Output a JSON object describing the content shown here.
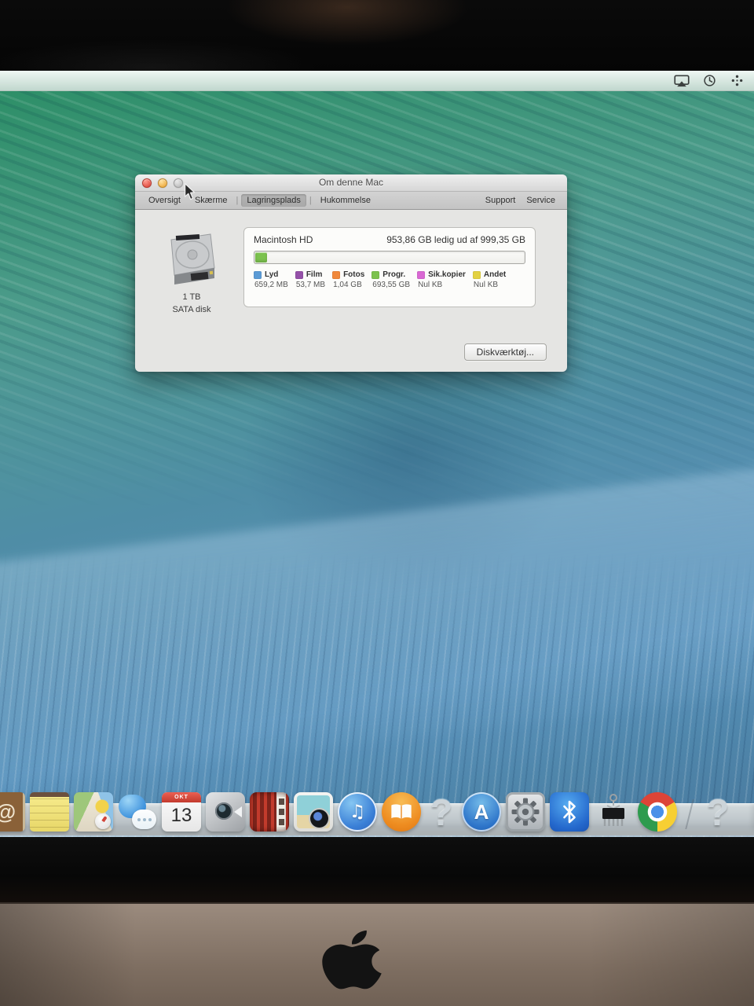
{
  "menubar": {
    "icons": [
      {
        "name": "airplay-icon"
      },
      {
        "name": "time-machine-icon"
      },
      {
        "name": "menu-extra-icon"
      }
    ]
  },
  "window": {
    "title": "Om denne Mac",
    "tabs": [
      {
        "label": "Oversigt",
        "active": false
      },
      {
        "label": "Skærme",
        "active": false
      },
      {
        "label": "Lagringsplads",
        "active": true
      },
      {
        "label": "Hukommelse",
        "active": false
      }
    ],
    "tab_separator": "|",
    "support_label": "Support",
    "service_label": "Service",
    "storage": {
      "disk_name": "Macintosh HD",
      "free_text": "953,86 GB ledig ud af 999,35 GB",
      "disk_size_label": "1 TB",
      "disk_type_label": "SATA disk",
      "bar": {
        "used_percent": 4.3,
        "used_color": "#7cc24e"
      },
      "legend": [
        {
          "label": "Lyd",
          "value": "659,2 MB",
          "color": "#5b9bd5"
        },
        {
          "label": "Film",
          "value": "53,7 MB",
          "color": "#9451a8"
        },
        {
          "label": "Fotos",
          "value": "1,04 GB",
          "color": "#f0883c"
        },
        {
          "label": "Progr.",
          "value": "693,55 GB",
          "color": "#7cc24e"
        },
        {
          "label": "Sik.kopier",
          "value": "Nul KB",
          "color": "#d969d3"
        },
        {
          "label": "Andet",
          "value": "Nul KB",
          "color": "#e3d141"
        }
      ],
      "disk_utility_button": "Diskværktøj..."
    }
  },
  "dock": {
    "calendar": {
      "month": "OKT",
      "day": "13"
    },
    "glyphs": {
      "contacts": "@",
      "app_store": "A",
      "missing": "?",
      "itunes": "♫"
    },
    "items": [
      "contacts",
      "notes",
      "maps",
      "messages",
      "calendar",
      "facetime",
      "photo-booth",
      "iphoto",
      "itunes",
      "ibooks",
      "missing-app",
      "app-store",
      "system-preferences",
      "bluetooth-exchange",
      "chip-utility",
      "chrome",
      "missing-app"
    ]
  }
}
